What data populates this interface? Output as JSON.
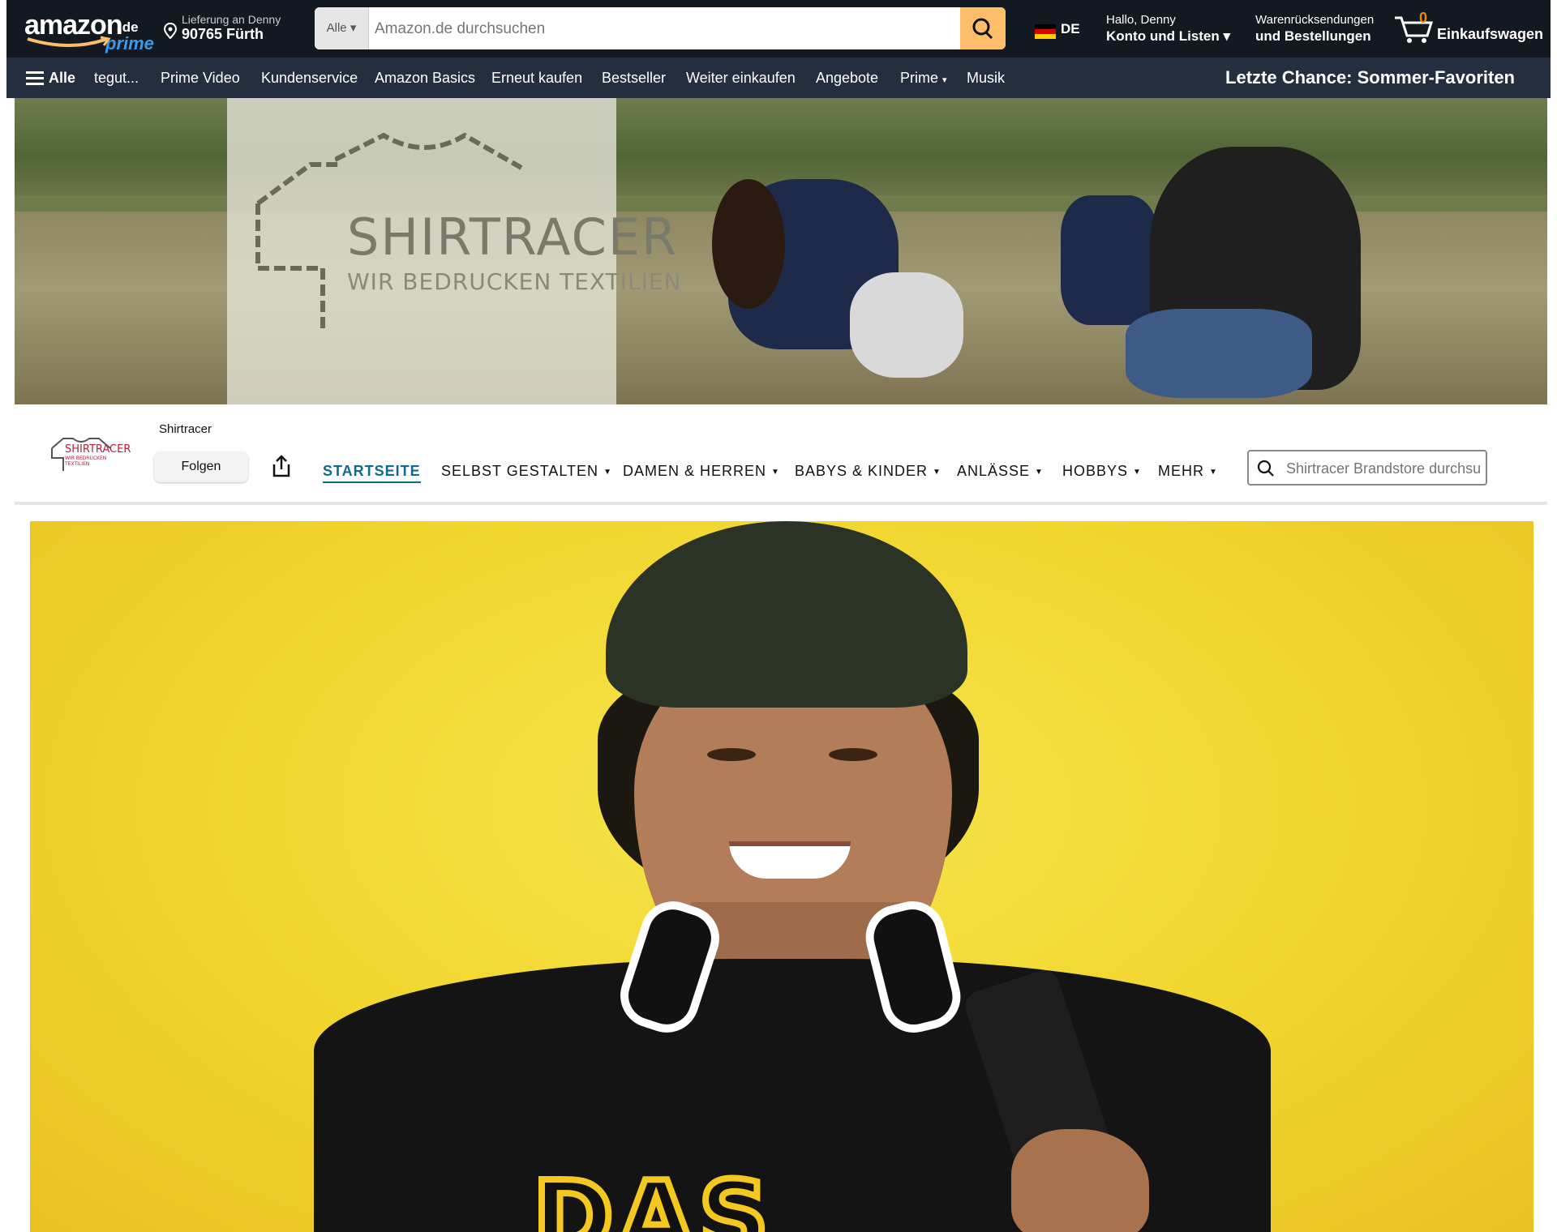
{
  "header": {
    "logo_word": "amazon",
    "logo_tld": ".de",
    "logo_prime": "prime",
    "delivery_line1": "Lieferung an Denny",
    "delivery_line2": "90765 Fürth",
    "search_category": "Alle",
    "search_placeholder": "Amazon.de durchsuchen",
    "language": "DE",
    "account_line1": "Hallo, Denny",
    "account_line2": "Konto und Listen",
    "orders_line1": "Warenrücksendungen",
    "orders_line2": "und Bestellungen",
    "cart_count": "0",
    "cart_label": "Einkaufswagen"
  },
  "nav": {
    "all_label": "Alle",
    "items": [
      "tegut...",
      "Prime Video",
      "Kundenservice",
      "Amazon Basics",
      "Erneut kaufen",
      "Bestseller",
      "Weiter einkaufen",
      "Angebote",
      "Prime",
      "Musik"
    ],
    "promo": "Letzte Chance: Sommer-Favoriten"
  },
  "hero": {
    "brand": "SHIRTRACER",
    "tagline": "WIR BEDRUCKEN TEXTILIEN"
  },
  "store": {
    "logo_text": "SHIRTRACER",
    "logo_subtext": "WIR BEDRUCKEN TEXTILIEN",
    "name": "Shirtracer",
    "follow_label": "Folgen",
    "nav": [
      "STARTSEITE",
      "SELBST GESTALTEN",
      "DAMEN & HERREN",
      "BABYS & KINDER",
      "ANLÄSSE",
      "HOBBYS",
      "MEHR"
    ],
    "search_placeholder": "Shirtracer Brandstore durchsu"
  },
  "photo": {
    "shirt_print": "DAS"
  },
  "colors": {
    "header_bg": "#131921",
    "nav_bg": "#232f3e",
    "search_button": "#febd69",
    "prime_blue": "#3a9bea",
    "active_tab": "#0e6b8c",
    "photo_bg": "#f1d52d"
  }
}
